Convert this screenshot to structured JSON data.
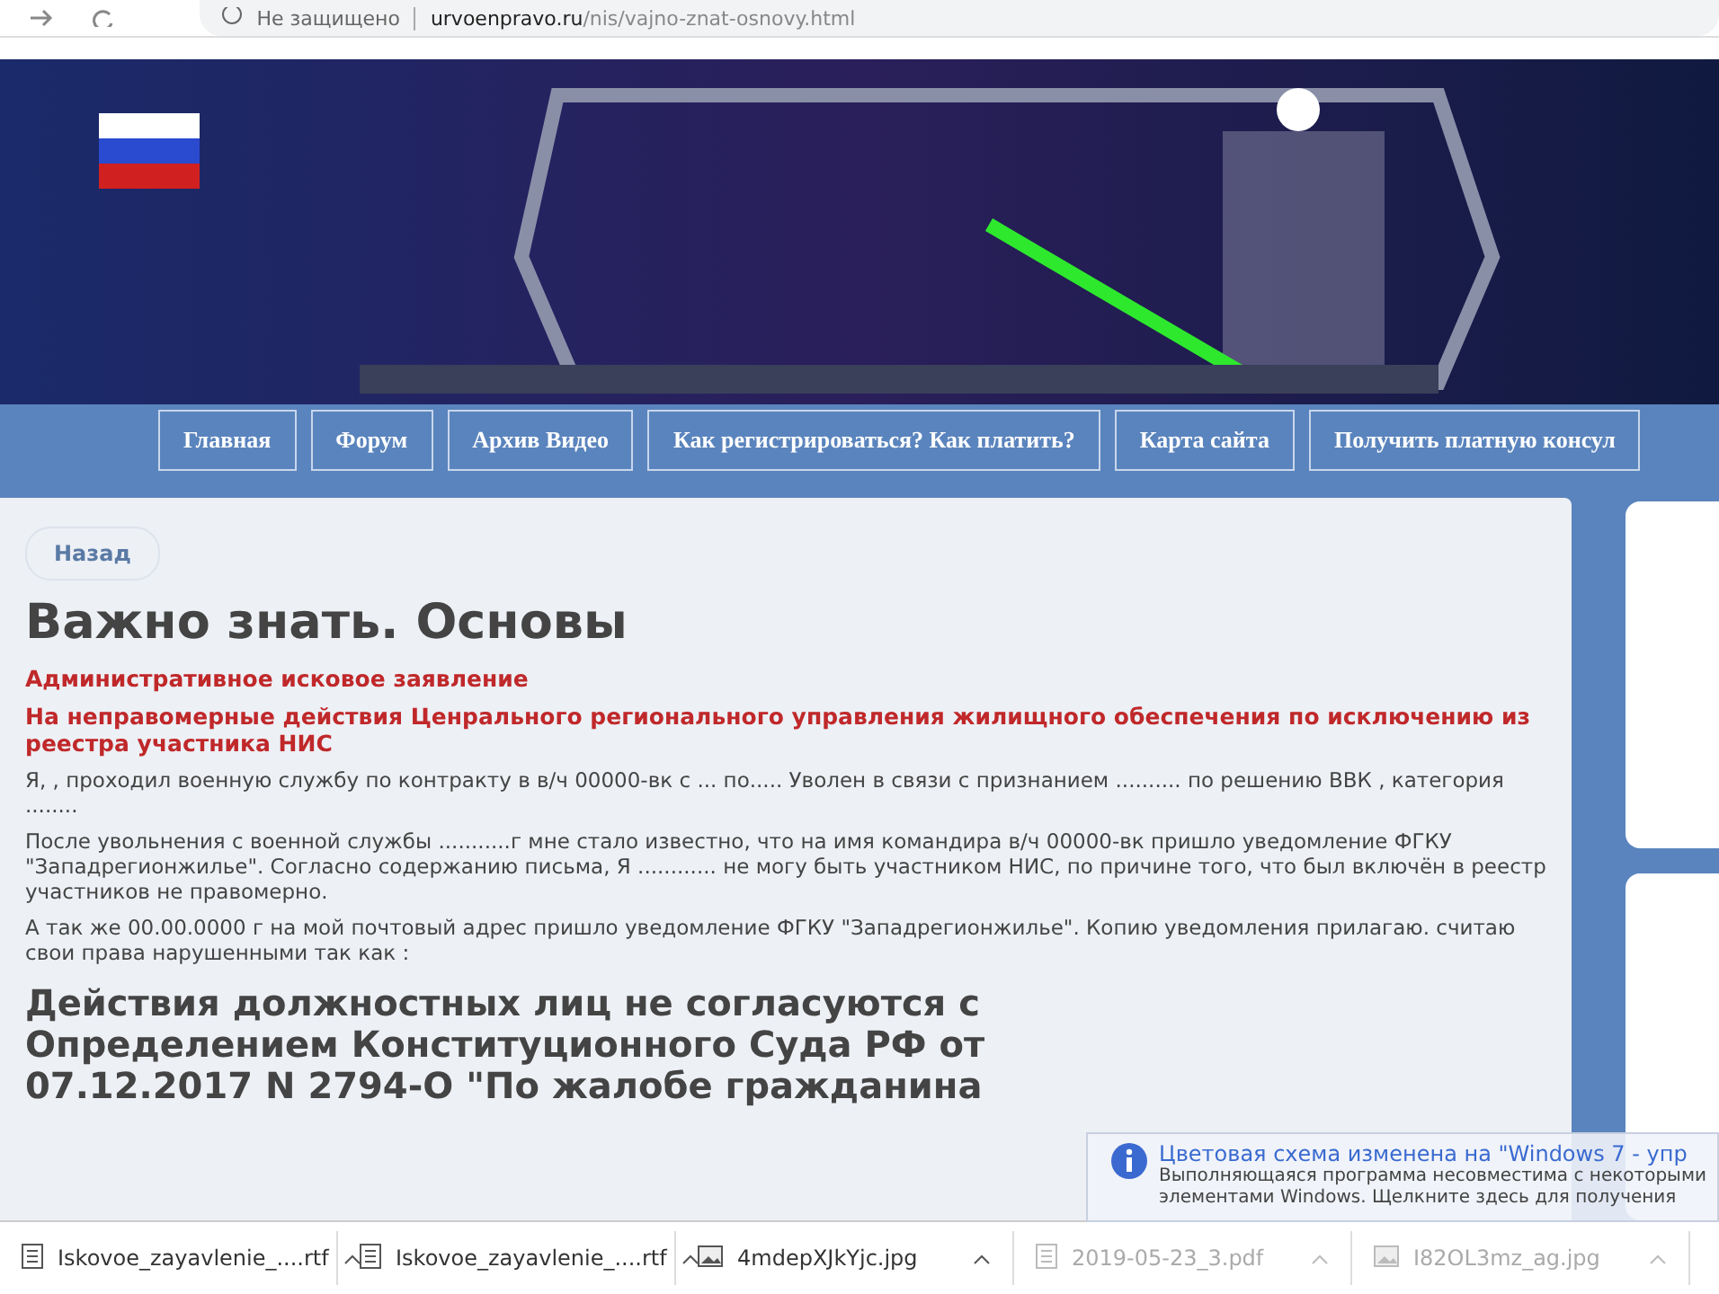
{
  "address_bar": {
    "security": "Не защищено",
    "domain": "urvoenpravo.ru",
    "path": "/nis/vajno-znat-osnovy.html"
  },
  "nav": [
    {
      "label": "Главная"
    },
    {
      "label": "Форум"
    },
    {
      "label": "Архив Видео"
    },
    {
      "label": "Как регистрироваться? Как платить?"
    },
    {
      "label": "Карта сайта"
    },
    {
      "label": "Получить платную консул"
    }
  ],
  "back_button": "Назад",
  "title": "Важно знать. Основы",
  "subtitle": "Административное исковое заявление",
  "subject": "На неправомерные действия Ценрального регионального управления жилищного обеспечения по исключению из реестра участника НИС",
  "paragraphs": [
    "Я, , проходил военную службу по контракту в в/ч 00000-вк с ... по..... Уволен в связи с признанием .......... по решению ВВК , категория ........",
    "После увольнения с военной службы ...........г мне стало известно, что на имя командира в/ч 00000-вк пришло уведомление  ФГКУ \"Западрегионжилье\". Согласно содержанию письма, Я ............ не могу быть участником НИС, по причине того, что был включён в реестр участников не правомерно.",
    "А так же 00.00.0000 г на мой почтовый адрес пришло уведомление ФГКУ \"Западрегионжилье\". Копию уведомления прилагаю. считаю свои права нарушенными так как :"
  ],
  "heading": "Действия должностных лиц не согласуются с Определением Конституционного Суда РФ от 07.12.2017 N 2794-О \"По жалобе гражданина",
  "downloads": [
    {
      "name": "Iskovoe_zayavlenie_....rtf",
      "kind": "doc",
      "faded": false
    },
    {
      "name": "Iskovoe_zayavlenie_....rtf",
      "kind": "doc",
      "faded": false
    },
    {
      "name": "4mdepXJkYjc.jpg",
      "kind": "image",
      "faded": false
    },
    {
      "name": "2019-05-23_3.pdf",
      "kind": "doc",
      "faded": true
    },
    {
      "name": "I82OL3mz_ag.jpg",
      "kind": "image",
      "faded": true
    }
  ],
  "notification": {
    "title": "Цветовая схема изменена на \"Windows 7 - упр",
    "lines": [
      "Выполняющаяся программа несовместима с некоторыми",
      "элементами Windows. Щелкните здесь для получения"
    ]
  }
}
